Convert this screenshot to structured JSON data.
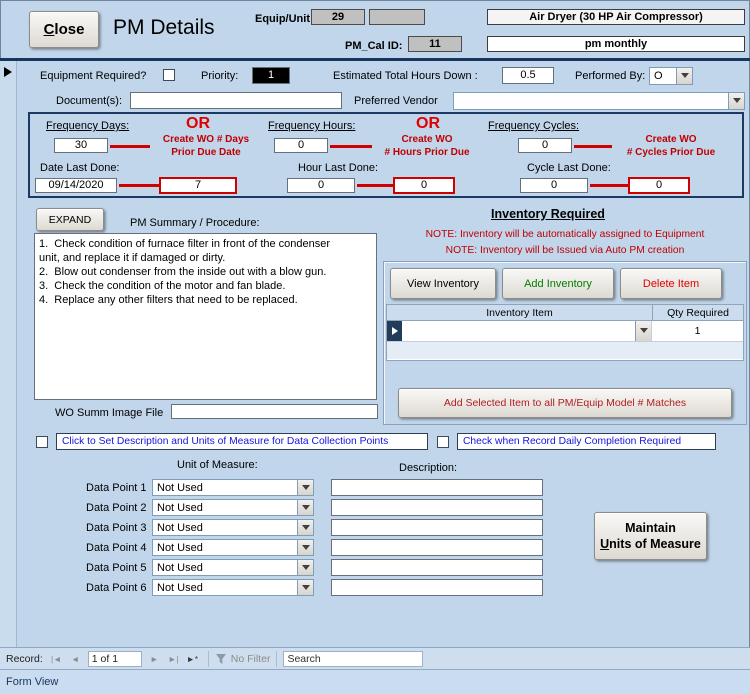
{
  "colors": {
    "form_bg": "#c1d6ea",
    "accent_red": "#cf0000",
    "note_red": "#c00000",
    "link_blue": "#1414dc",
    "add_green": "#008000",
    "panel_navy": "#17365d"
  },
  "header": {
    "close_label": "Close",
    "title": "PM Details",
    "equip_unit_id_label": "Equip/Unit ID:",
    "equip_unit_id": "29",
    "equip_name": "Air Dryer (30 HP Air Compressor)",
    "pm_cal_id_label": "PM_Cal ID:",
    "pm_cal_id": "11",
    "pm_name": "pm monthly"
  },
  "general": {
    "equipment_required_label": "Equipment Required?",
    "priority_label": "Priority:",
    "priority_value": "1",
    "est_hours_label": "Estimated Total Hours Down :",
    "est_hours_value": "0.5",
    "performed_by_label": "Performed By:",
    "performed_by_value": "O",
    "documents_label": "Document(s):",
    "documents_value": "",
    "preferred_vendor_label": "Preferred Vendor",
    "preferred_vendor_value": ""
  },
  "frequency": {
    "days_label": "Frequency Days:",
    "days_value": "30",
    "or_label": "OR",
    "days_note": "Create WO # Days\nPrior Due Date",
    "hours_label": "Frequency Hours:",
    "hours_value": "0",
    "hours_note": "Create WO\n# Hours Prior Due",
    "cycles_label": "Frequency Cycles:",
    "cycles_value": "0",
    "cycles_note": "Create WO\n# Cycles Prior Due",
    "date_last_done_label": "Date Last Done:",
    "date_last_done_value": "09/14/2020",
    "days_prior_value": "7",
    "hour_last_done_label": "Hour Last Done:",
    "hour_last_done_value": "0",
    "hours_prior_value": "0",
    "cycle_last_done_label": "Cycle Last Done:",
    "cycle_last_done_value": "0",
    "cycles_prior_value": "0"
  },
  "summary": {
    "expand_label": "EXPAND",
    "label": "PM Summary / Procedure:",
    "text": "1.  Check condition of furnace filter in front of the condenser\nunit, and replace it if damaged or dirty.\n2.  Blow out condenser from the inside out with a blow gun.\n3.  Check the condition of the motor and fan blade.\n4.  Replace any other filters that need to be replaced.",
    "wo_summ_label": "WO Summ Image File",
    "wo_summ_value": ""
  },
  "inventory": {
    "title": "Inventory Required",
    "note1": "NOTE: Inventory will be automatically assigned to Equipment",
    "note2": "NOTE: Inventory will be Issued via Auto PM creation",
    "view_inventory_label": "View Inventory",
    "add_inventory_label": "Add Inventory",
    "delete_item_label": "Delete Item",
    "item_column": "Inventory Item",
    "qty_column": "Qty Required",
    "selected_item_value": "",
    "qty_value": "1",
    "add_selected_label": "Add Selected Item to all PM/Equip Model # Matches"
  },
  "data_collection": {
    "set_description_label": "Click to Set Description and  Units of Measure for Data Collection Points",
    "daily_completion_label": "Check when Record Daily Completion Required",
    "unit_of_measure_label": "Unit of Measure:",
    "description_label": "Description:",
    "points": [
      {
        "label": "Data Point 1",
        "unit": "Not Used",
        "description": ""
      },
      {
        "label": "Data Point 2",
        "unit": "Not Used",
        "description": ""
      },
      {
        "label": "Data Point 3",
        "unit": "Not Used",
        "description": ""
      },
      {
        "label": "Data Point 4",
        "unit": "Not Used",
        "description": ""
      },
      {
        "label": "Data Point 5",
        "unit": "Not Used",
        "description": ""
      },
      {
        "label": "Data Point 6",
        "unit": "Not Used",
        "description": ""
      }
    ],
    "maintain_button_line1": "Maintain",
    "maintain_button_line2": "Units of Measure"
  },
  "record_nav": {
    "label": "Record:",
    "position": "1 of 1",
    "icons": {
      "first": "|◄",
      "prev": "◄",
      "next": "►",
      "last": "►|",
      "new_record": "►*"
    },
    "no_filter_label": "No Filter",
    "search_value": "Search"
  },
  "status_bar": {
    "text": "Form View"
  }
}
